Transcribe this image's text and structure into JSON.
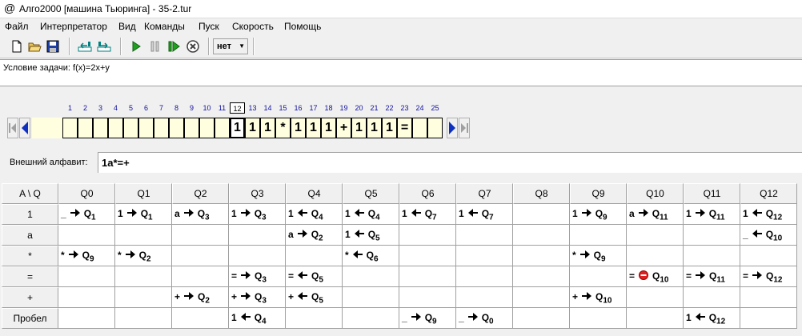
{
  "window": {
    "title": "Алго2000 [машина Тьюринга] - 35-2.tur",
    "app_icon": "@"
  },
  "menu": [
    "Файл",
    "Интерпретатор",
    "Вид",
    "Команды",
    "Пуск",
    "Скорость",
    "Помощь"
  ],
  "toolbar": {
    "buttons": [
      "new-file-icon",
      "open-folder-icon",
      "save-icon",
      "tape-left-icon",
      "tape-right-icon",
      "run-icon",
      "pause-icon",
      "step-icon",
      "stop-icon"
    ],
    "speed_value": "нет"
  },
  "condition": "Условие задачи: f(x)=2x+y",
  "tape": {
    "indices": [
      "1",
      "2",
      "3",
      "4",
      "5",
      "6",
      "7",
      "8",
      "9",
      "10",
      "11",
      "12",
      "13",
      "14",
      "15",
      "16",
      "17",
      "18",
      "19",
      "20",
      "21",
      "22",
      "23",
      "24",
      "25"
    ],
    "current_index": 12,
    "cells": [
      "",
      "",
      "",
      "",
      "",
      "",
      "",
      "",
      "",
      "",
      "",
      "1",
      "1",
      "1",
      "*",
      "1",
      "1",
      "1",
      "+",
      "1",
      "1",
      "1",
      "=",
      "",
      ""
    ]
  },
  "alphabet": {
    "label": "Внешний алфавит:",
    "value": "1a*=+"
  },
  "table": {
    "corner": "A \\ Q",
    "states": [
      "Q0",
      "Q1",
      "Q2",
      "Q3",
      "Q4",
      "Q5",
      "Q6",
      "Q7",
      "Q8",
      "Q9",
      "Q10",
      "Q11",
      "Q12"
    ],
    "rows": [
      {
        "symbol": "1",
        "cells": [
          {
            "w": "_",
            "d": "R",
            "q": "1"
          },
          {
            "w": "1",
            "d": "R",
            "q": "1"
          },
          {
            "w": "a",
            "d": "R",
            "q": "3"
          },
          {
            "w": "1",
            "d": "R",
            "q": "3"
          },
          {
            "w": "1",
            "d": "L",
            "q": "4"
          },
          {
            "w": "1",
            "d": "L",
            "q": "4"
          },
          {
            "w": "1",
            "d": "L",
            "q": "7"
          },
          {
            "w": "1",
            "d": "L",
            "q": "7"
          },
          null,
          {
            "w": "1",
            "d": "R",
            "q": "9"
          },
          {
            "w": "a",
            "d": "R",
            "q": "11"
          },
          {
            "w": "1",
            "d": "R",
            "q": "11"
          },
          {
            "w": "1",
            "d": "L",
            "q": "12"
          }
        ]
      },
      {
        "symbol": "a",
        "cells": [
          null,
          null,
          null,
          null,
          {
            "w": "a",
            "d": "R",
            "q": "2"
          },
          {
            "w": "1",
            "d": "L",
            "q": "5"
          },
          null,
          null,
          null,
          null,
          null,
          null,
          {
            "w": "_",
            "d": "L",
            "q": "10"
          }
        ]
      },
      {
        "symbol": "*",
        "cells": [
          {
            "w": "*",
            "d": "R",
            "q": "9"
          },
          {
            "w": "*",
            "d": "R",
            "q": "2"
          },
          null,
          null,
          null,
          {
            "w": "*",
            "d": "L",
            "q": "6"
          },
          null,
          null,
          null,
          {
            "w": "*",
            "d": "R",
            "q": "9"
          },
          null,
          null,
          null
        ]
      },
      {
        "symbol": "=",
        "cells": [
          null,
          null,
          null,
          {
            "w": "=",
            "d": "R",
            "q": "3"
          },
          {
            "w": "=",
            "d": "L",
            "q": "5"
          },
          null,
          null,
          null,
          null,
          null,
          {
            "w": "=",
            "d": "S",
            "q": "10"
          },
          {
            "w": "=",
            "d": "R",
            "q": "11"
          },
          {
            "w": "=",
            "d": "R",
            "q": "12"
          }
        ]
      },
      {
        "symbol": "+",
        "cells": [
          null,
          null,
          {
            "w": "+",
            "d": "R",
            "q": "2"
          },
          {
            "w": "+",
            "d": "R",
            "q": "3"
          },
          {
            "w": "+",
            "d": "L",
            "q": "5"
          },
          null,
          null,
          null,
          null,
          {
            "w": "+",
            "d": "R",
            "q": "10"
          },
          null,
          null,
          null
        ]
      },
      {
        "symbol": "Пробел",
        "cells": [
          null,
          null,
          null,
          {
            "w": "1",
            "d": "L",
            "q": "4"
          },
          null,
          null,
          {
            "w": "_",
            "d": "R",
            "q": "9"
          },
          {
            "w": "_",
            "d": "R",
            "q": "0"
          },
          null,
          null,
          null,
          {
            "w": "1",
            "d": "L",
            "q": "12"
          },
          null
        ]
      }
    ]
  }
}
